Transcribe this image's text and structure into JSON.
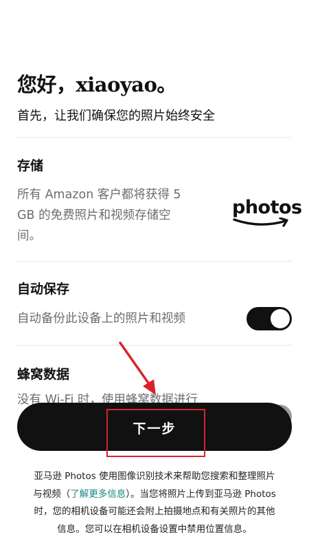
{
  "header": {
    "greeting": "您好，xiaoyao。",
    "subtitle": "首先，让我们确保您的照片始终安全"
  },
  "storage": {
    "title": "存储",
    "description_lines": [
      "所有 Amazon 客户都将获得 5",
      "GB 的免费照片和视频存储空",
      "间。"
    ],
    "logo_text": "photos",
    "logo_icon": "amazon-smile-arrow"
  },
  "auto_save": {
    "title": "自动保存",
    "description": "自动备份此设备上的照片和视频",
    "toggle_on": true
  },
  "cellular": {
    "title": "蜂窝数据",
    "description_partial": "没有 Wi-Fi 时，使用蜂窝数据进行"
  },
  "next_button": {
    "label": "下一步"
  },
  "annotation": {
    "color": "#d9232b"
  },
  "footer": {
    "line1": "亚马逊 Photos 使用图像识别技术来帮助您搜索和整理照片",
    "line2_before": "与视频（",
    "learn_more_link": "了解更多信息",
    "line2_after": "）。当您将照片上传到亚马逊 Photos",
    "line3": "时，您的相机设备可能还会附上拍摄地点和有关照片的其他",
    "line4": "信息。您可以在相机设备设置中禁用位置信息。",
    "link_color": "#1a8585"
  }
}
